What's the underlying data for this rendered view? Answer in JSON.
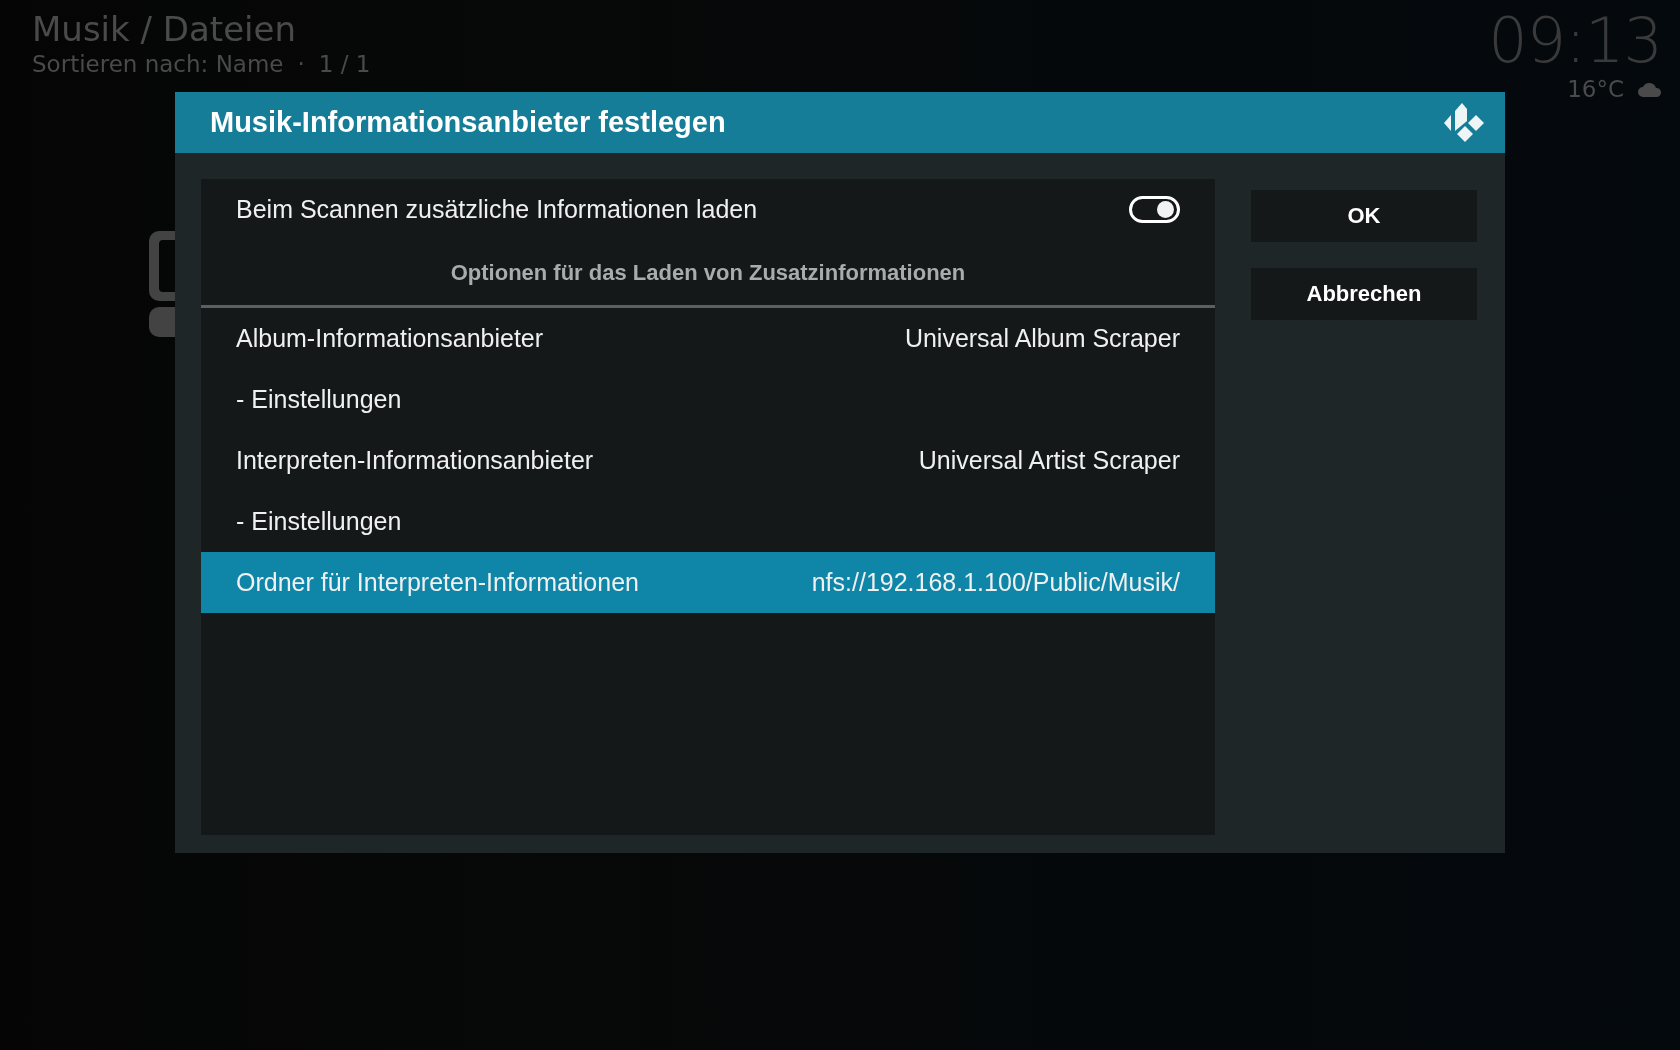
{
  "background": {
    "title": "Musik / Dateien",
    "sort_label": "Sortieren nach: Name",
    "separator": "·",
    "page": "1 / 1"
  },
  "clock": {
    "time": "09:13",
    "temperature": "16°C"
  },
  "dialog": {
    "title": "Musik-Informationsanbieter festlegen",
    "rows": [
      {
        "kind": "toggle",
        "label": "Beim Scannen zusätzliche Informationen laden",
        "on": true,
        "selected": false
      },
      {
        "kind": "section",
        "label": "Optionen für das Laden von Zusatzinformationen"
      },
      {
        "kind": "value",
        "label": "Album-Informationsanbieter",
        "value": "Universal Album Scraper",
        "selected": false
      },
      {
        "kind": "value",
        "label": "- Einstellungen",
        "selected": false
      },
      {
        "kind": "value",
        "label": "Interpreten-Informationsanbieter",
        "value": "Universal Artist Scraper",
        "selected": false
      },
      {
        "kind": "value",
        "label": "- Einstellungen",
        "selected": false
      },
      {
        "kind": "value",
        "label": "Ordner für Interpreten-Informationen",
        "value": "nfs://192.168.1.100/Public/Musik/",
        "selected": true
      }
    ],
    "buttons": [
      {
        "label": "OK"
      },
      {
        "label": "Abbrechen"
      }
    ]
  }
}
